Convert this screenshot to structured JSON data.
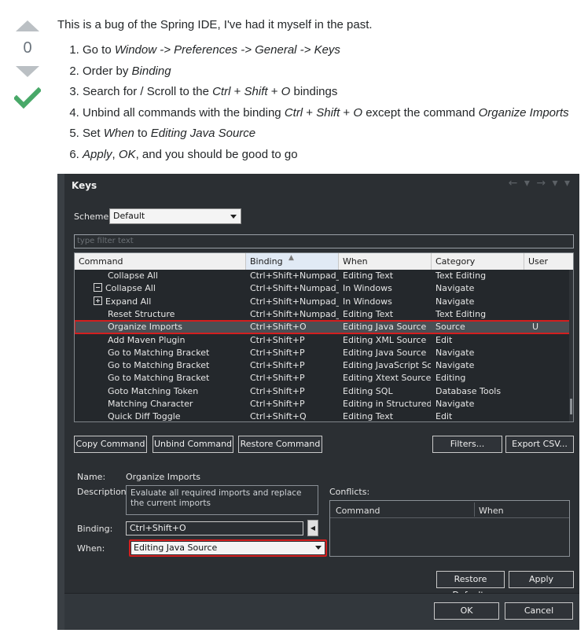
{
  "vote": {
    "count": "0",
    "colors": {
      "arrow": "#bbc0c4",
      "accepted": "#48a868"
    }
  },
  "answer": {
    "intro": "This is a bug of the Spring IDE, I've had it myself in the past.",
    "steps": [
      [
        {
          "t": "Go to "
        },
        {
          "t": "Window -> Preferences -> General -> Keys",
          "em": true
        }
      ],
      [
        {
          "t": "Order by "
        },
        {
          "t": "Binding",
          "em": true
        }
      ],
      [
        {
          "t": "Search for / Scroll to the "
        },
        {
          "t": "Ctrl",
          "em": true
        },
        {
          "t": " + "
        },
        {
          "t": "Shift",
          "em": true
        },
        {
          "t": " + "
        },
        {
          "t": "O",
          "em": true
        },
        {
          "t": " bindings"
        }
      ],
      [
        {
          "t": "Unbind all commands with the binding "
        },
        {
          "t": "Ctrl",
          "em": true
        },
        {
          "t": " + "
        },
        {
          "t": "Shift",
          "em": true
        },
        {
          "t": " + "
        },
        {
          "t": "O",
          "em": true
        },
        {
          "t": " except the command "
        },
        {
          "t": "Organize Imports",
          "em": true
        }
      ],
      [
        {
          "t": "Set "
        },
        {
          "t": "When",
          "em": true
        },
        {
          "t": " to "
        },
        {
          "t": "Editing Java Source",
          "em": true
        }
      ],
      [
        {
          "t": "Apply",
          "em": true
        },
        {
          "t": ", "
        },
        {
          "t": "OK",
          "em": true
        },
        {
          "t": ", and you should be good to go"
        }
      ]
    ]
  },
  "dialog": {
    "title": "Keys",
    "scheme_label": "Scheme:",
    "scheme_value": "Default",
    "filter_placeholder": "type filter text",
    "columns": [
      "Command",
      "Binding",
      "When",
      "Category",
      "User"
    ],
    "rows": [
      {
        "icon": "",
        "command": "Collapse All",
        "binding": "Ctrl+Shift+Numpad_...",
        "when": "Editing Text",
        "category": "Text Editing",
        "user": ""
      },
      {
        "icon": "minus",
        "command": "Collapse All",
        "binding": "Ctrl+Shift+Numpad_...",
        "when": "In Windows",
        "category": "Navigate",
        "user": ""
      },
      {
        "icon": "plus",
        "command": "Expand All",
        "binding": "Ctrl+Shift+Numpad_...",
        "when": "In Windows",
        "category": "Navigate",
        "user": ""
      },
      {
        "icon": "",
        "command": "Reset Structure",
        "binding": "Ctrl+Shift+Numpad_...",
        "when": "Editing Text",
        "category": "Text Editing",
        "user": ""
      },
      {
        "icon": "",
        "command": "Organize Imports",
        "binding": "Ctrl+Shift+O",
        "when": "Editing Java Source",
        "category": "Source",
        "user": "U",
        "selected": true
      },
      {
        "icon": "",
        "command": "Add Maven Plugin",
        "binding": "Ctrl+Shift+P",
        "when": "Editing XML Source",
        "category": "Edit",
        "user": ""
      },
      {
        "icon": "",
        "command": "Go to Matching Bracket",
        "binding": "Ctrl+Shift+P",
        "when": "Editing Java Source",
        "category": "Navigate",
        "user": ""
      },
      {
        "icon": "",
        "command": "Go to Matching Bracket",
        "binding": "Ctrl+Shift+P",
        "when": "Editing JavaScript So...",
        "category": "Navigate",
        "user": ""
      },
      {
        "icon": "",
        "command": "Go to Matching Bracket",
        "binding": "Ctrl+Shift+P",
        "when": "Editing Xtext Source",
        "category": "Editing",
        "user": ""
      },
      {
        "icon": "",
        "command": "Goto Matching Token",
        "binding": "Ctrl+Shift+P",
        "when": "Editing SQL",
        "category": "Database Tools",
        "user": ""
      },
      {
        "icon": "",
        "command": "Matching Character",
        "binding": "Ctrl+Shift+P",
        "when": "Editing in Structured ...",
        "category": "Navigate",
        "user": ""
      },
      {
        "icon": "",
        "command": "Quick Diff Toggle",
        "binding": "Ctrl+Shift+Q",
        "when": "Editing Text",
        "category": "Edit",
        "user": ""
      }
    ],
    "buttons": {
      "copy": "Copy Command",
      "unbind": "Unbind Command",
      "restore": "Restore Command",
      "filters": "Filters...",
      "export": "Export CSV...",
      "restore_defaults": "Restore Defaults",
      "apply": "Apply",
      "ok": "OK",
      "cancel": "Cancel"
    },
    "details": {
      "name_label": "Name:",
      "name_value": "Organize Imports",
      "desc_label": "Description:",
      "desc_value": "Evaluate all required imports and replace the current imports",
      "binding_label": "Binding:",
      "binding_value": "Ctrl+Shift+O",
      "when_label": "When:",
      "when_value": "Editing Java Source"
    },
    "conflicts": {
      "label": "Conflicts:",
      "col_command": "Command",
      "col_when": "When"
    },
    "colors": {
      "highlight": "#d31f1f"
    }
  }
}
